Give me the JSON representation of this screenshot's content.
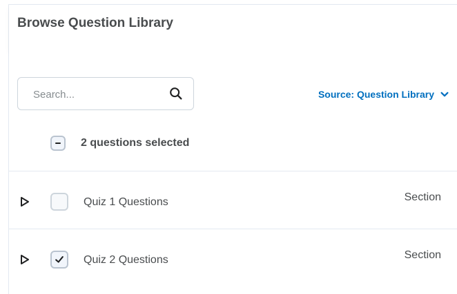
{
  "panel": {
    "title": "Browse Question Library"
  },
  "toolbar": {
    "search_placeholder": "Search...",
    "search_icon": "search-icon",
    "source_label": "Source: Question Library",
    "source_icon": "chevron-down-icon"
  },
  "selection": {
    "label": "2 questions selected",
    "state": "mixed"
  },
  "rows": [
    {
      "label": "Quiz 1 Questions",
      "type": "Section",
      "checked": false
    },
    {
      "label": "Quiz 2 Questions",
      "type": "Section",
      "checked": true
    }
  ],
  "colors": {
    "accent": "#006fbf",
    "border": "#e3e9f1",
    "text": "#494c4e",
    "muted": "#868c8f"
  }
}
